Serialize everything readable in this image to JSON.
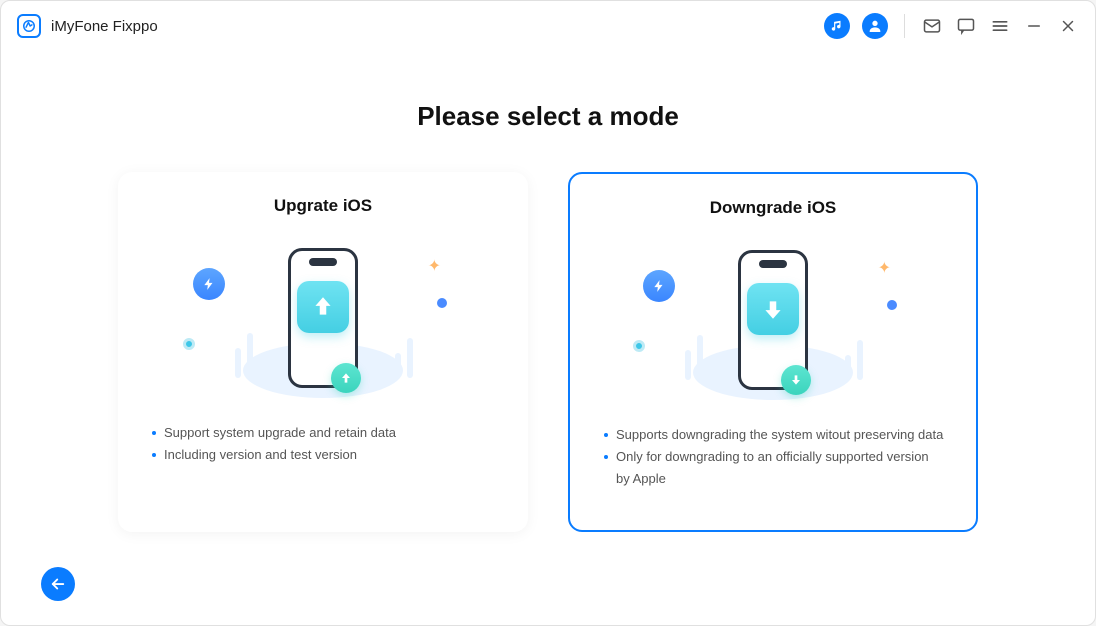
{
  "header": {
    "app_title": "iMyFone Fixppo"
  },
  "main": {
    "page_title": "Please select a mode",
    "cards": [
      {
        "title": "Upgrate iOS",
        "direction": "up",
        "bullets": [
          "Support system upgrade and retain data",
          "Including version and test version"
        ]
      },
      {
        "title": "Downgrade iOS",
        "direction": "down",
        "bullets": [
          "Supports downgrading the system witout preserving data",
          "Only for downgrading to an officially supported version by Apple"
        ]
      }
    ]
  }
}
